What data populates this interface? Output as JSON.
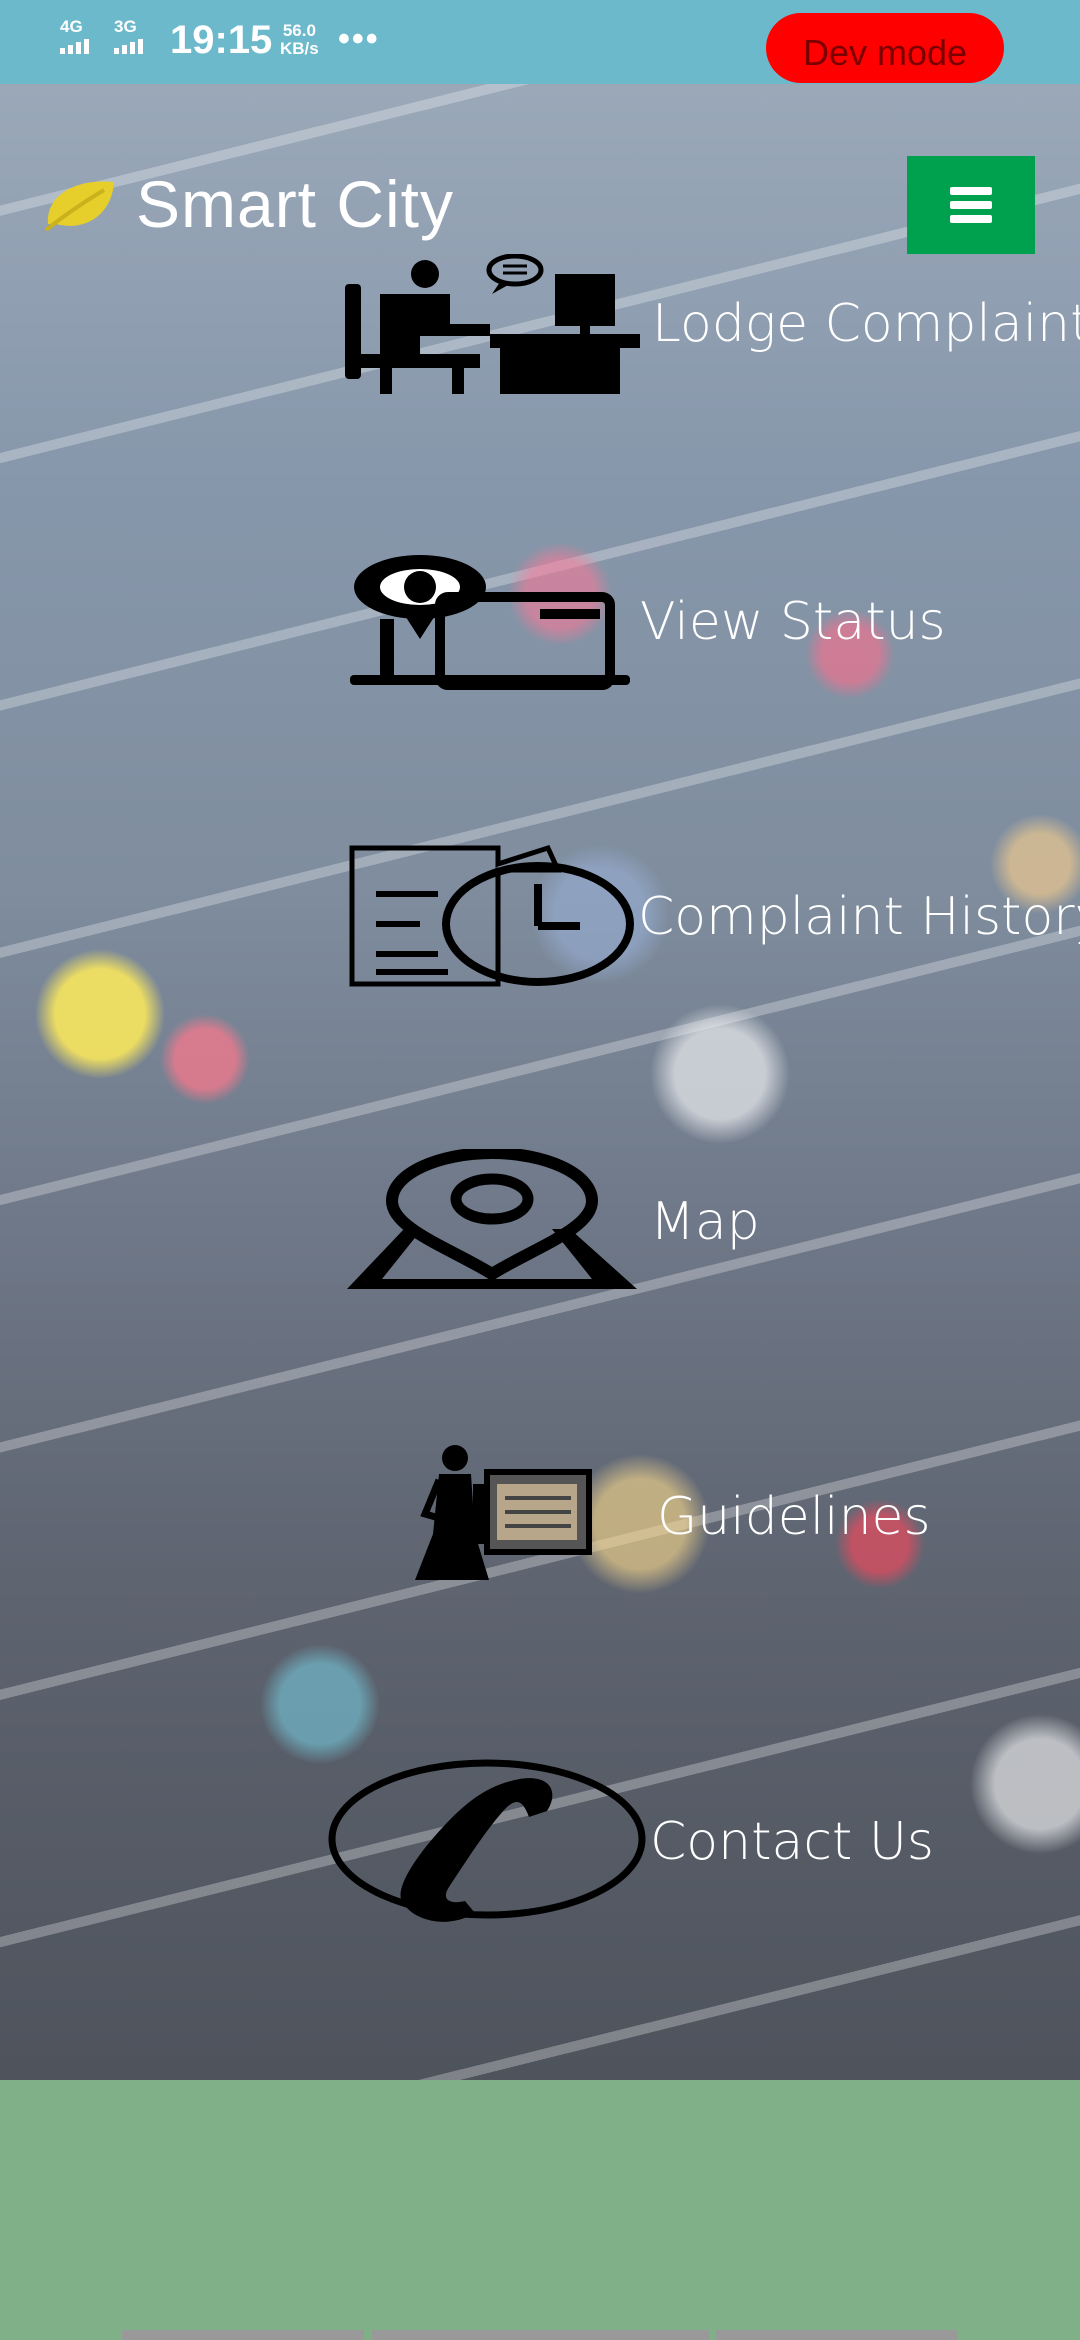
{
  "status_bar": {
    "network_1": "4G",
    "network_2": "3G",
    "time": "19:15",
    "speed_value": "56.0",
    "speed_unit": "KB/s",
    "more": "•••"
  },
  "dev_badge": "Dev mode",
  "header": {
    "title": "Smart City"
  },
  "menu": [
    {
      "label": "Lodge Complaint",
      "icon": "complaint-desk-icon"
    },
    {
      "label": "View Status",
      "icon": "eye-laptop-icon"
    },
    {
      "label": "Complaint History",
      "icon": "document-clock-icon"
    },
    {
      "label": "Map",
      "icon": "map-pin-icon"
    },
    {
      "label": "Guidelines",
      "icon": "person-board-icon"
    },
    {
      "label": "Contact Us",
      "icon": "phone-icon"
    }
  ],
  "colors": {
    "status_bar": "#6cb9cc",
    "dev_badge": "#ff0000",
    "menu_button": "#00a14e",
    "footer": "#80b088",
    "leaf": "#e6cf2a"
  }
}
